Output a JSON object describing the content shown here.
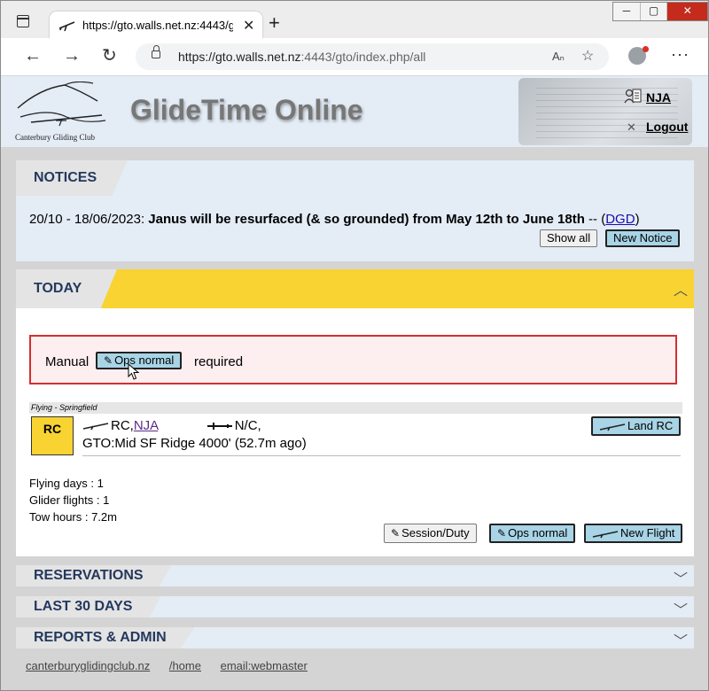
{
  "browser": {
    "tab_title": "https://gto.walls.net.nz:4443/gto/",
    "url_host": "https://gto.walls.net.nz",
    "url_rest": ":4443/gto/index.php/all",
    "close_glyph": "✕",
    "newtab_glyph": "+",
    "back_glyph": "←",
    "forward_glyph": "→",
    "reload_glyph": "↻",
    "readaloud_glyph": "Aₙ",
    "favorites_glyph": "☆",
    "menu_glyph": "···",
    "win_min": "─",
    "win_max": "▢",
    "win_close": "✕"
  },
  "header": {
    "club_name": "Canterbury Gliding Club",
    "site_title": "GlideTime Online",
    "user": "NJA",
    "logout": "Logout",
    "logout_glyph": "✕"
  },
  "notices": {
    "title": "NOTICES",
    "date": "20/10 - 18/06/2023:",
    "text": "Janus will be resurfaced (& so grounded) from May 12th to June 18th",
    "dash": "--",
    "open_paren": "(",
    "author": "DGD",
    "close_paren": ")",
    "show_all": "Show all",
    "new_notice": "New Notice"
  },
  "today": {
    "title": "TODAY",
    "collapse_glyph": "︿",
    "manual_label": "Manual",
    "ops_button": "Ops normal",
    "required_label": "required",
    "pencil_glyph": "✎",
    "flying_label": "Flying - Springfield",
    "tug_code": "RC",
    "pilot_prefix": "RC,",
    "pilot": "NJA",
    "glider_status": "N/C,",
    "gto_line": "GTO:Mid SF Ridge 4000' (52.7m ago)",
    "land_button": "Land RC",
    "stats": [
      "Flying days : 1",
      "Glider flights : 1",
      "Tow hours : 7.2m"
    ],
    "session_button": "Session/Duty",
    "ops_normal_button": "Ops normal",
    "new_flight_button": "New Flight"
  },
  "sections": [
    {
      "title": "RESERVATIONS",
      "glyph": "﹀"
    },
    {
      "title": "LAST 30 DAYS",
      "glyph": "﹀"
    },
    {
      "title": "REPORTS & ADMIN",
      "glyph": "﹀"
    }
  ],
  "footer": {
    "links": [
      "canterburyglidingclub.nz",
      "/home",
      " email:webmaster"
    ]
  },
  "colors": {
    "accent_yellow": "#f8d332",
    "button_blue": "#a8d4e6",
    "header_bg": "#e4ecf6",
    "alert_red": "#d32f2f"
  }
}
